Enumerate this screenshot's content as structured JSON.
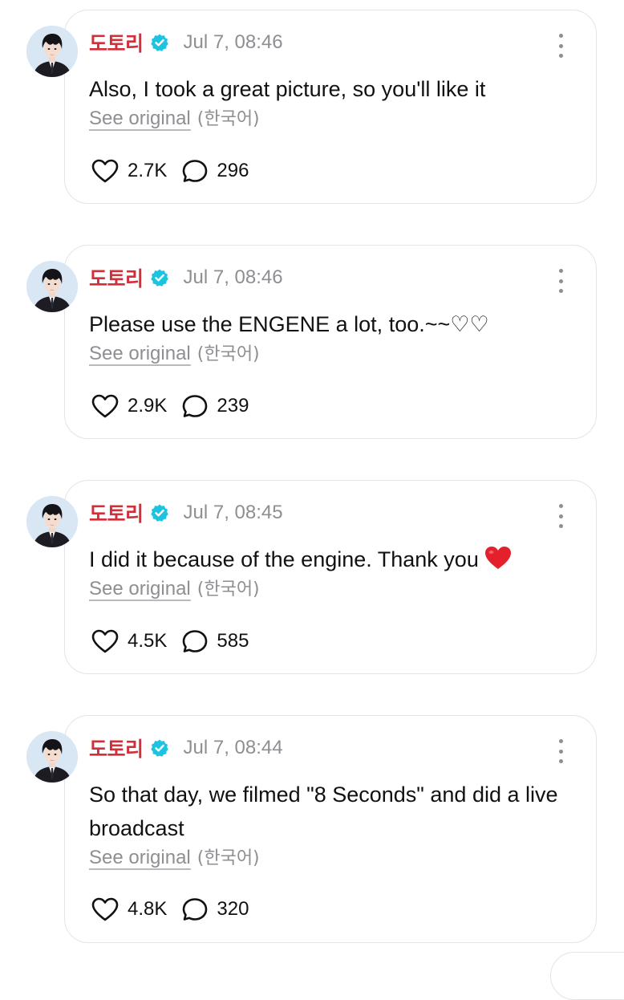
{
  "posts": [
    {
      "author": "도토리",
      "time": "Jul 7, 08:46",
      "text": "Also, I took a great picture, so you'll like it",
      "see_original": "See original",
      "language": "(한국어)",
      "likes": "2.7K",
      "comments": "296"
    },
    {
      "author": "도토리",
      "time": "Jul 7, 08:46",
      "text": "Please use the ENGENE a lot, too.~~♡♡",
      "see_original": "See original",
      "language": "(한국어)",
      "likes": "2.9K",
      "comments": "239"
    },
    {
      "author": "도토리",
      "time": "Jul 7, 08:45",
      "text": "I did it because of the engine. Thank you",
      "emoji": "red-heart-icon",
      "see_original": "See original",
      "language": "(한국어)",
      "likes": "4.5K",
      "comments": "585"
    },
    {
      "author": "도토리",
      "time": "Jul 7, 08:44",
      "text": "So that day, we filmed \"8 Seconds\" and did a live broadcast",
      "see_original": "See original",
      "language": "(한국어)",
      "likes": "4.8K",
      "comments": "320"
    }
  ],
  "icons": {
    "verified": "verified-badge-icon",
    "more": "more-options-icon",
    "like": "heart-outline-icon",
    "comment": "comment-bubble-icon"
  },
  "colors": {
    "author": "#d1303b",
    "verified": "#1ec3e0",
    "meta": "#8e8e93",
    "border": "#e4e4e8",
    "emoji_heart": "#e4202c"
  }
}
